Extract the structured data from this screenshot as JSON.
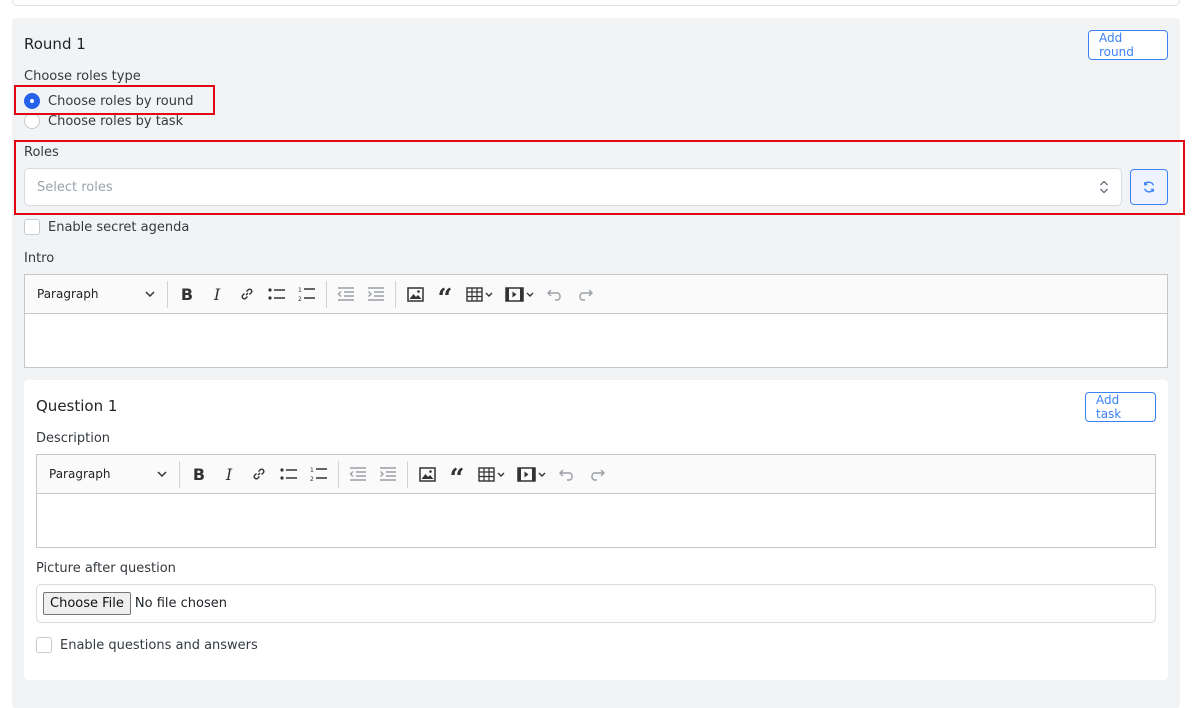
{
  "round": {
    "title": "Round 1",
    "add_round_label": "Add round",
    "roles_type_label": "Choose roles type",
    "radio_by_round": "Choose roles by round",
    "radio_by_task": "Choose roles by task",
    "roles_label": "Roles",
    "roles_placeholder": "Select roles",
    "secret_agenda_label": "Enable secret agenda",
    "intro_label": "Intro",
    "editor_paragraph": "Paragraph"
  },
  "question": {
    "title": "Question 1",
    "add_task_label": "Add task",
    "description_label": "Description",
    "editor_paragraph": "Paragraph",
    "picture_label": "Picture after question",
    "choose_file_label": "Choose File",
    "no_file_text": "No file chosen",
    "qa_label": "Enable questions and answers"
  },
  "colors": {
    "accent": "#2563eb",
    "highlight": "#e30613",
    "card_bg": "#f2f3f5"
  }
}
